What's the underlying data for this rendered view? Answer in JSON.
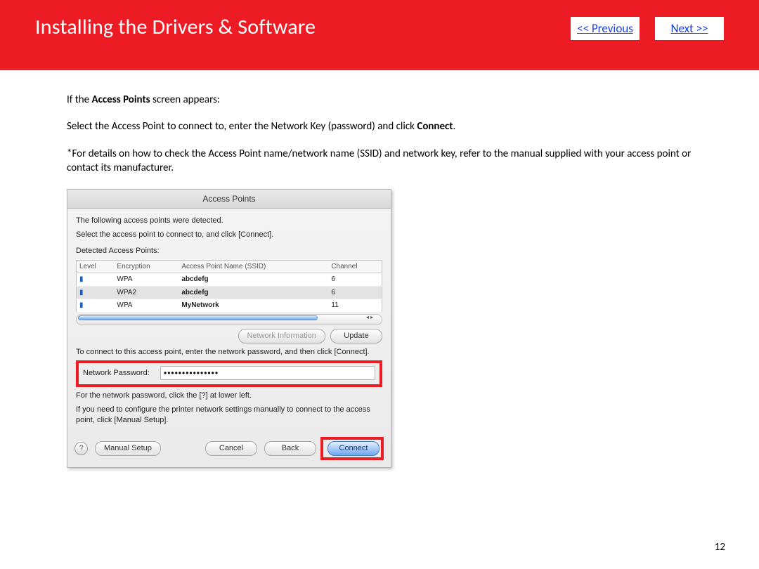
{
  "header": {
    "title": "Installing  the Drivers & Software",
    "prev": "<< Previous",
    "next": "Next >>"
  },
  "body": {
    "p1a": "If the ",
    "p1b": "Access Points",
    "p1c": " screen appears:",
    "p2a": "Select  the  Access Point to connect to, enter the Network Key (password) and click ",
    "p2b": "Connect",
    "p2c": ".",
    "note": "*For details on how to check the Access Point name/network name (SSID) and network key, refer to the manual supplied with your access point or contact its manufacturer."
  },
  "window": {
    "title": "Access Points",
    "intro1": "The following access points were detected.",
    "intro2": "Select the access point to connect to, and click [Connect].",
    "dap_label": "Detected Access Points:",
    "cols": {
      "level": "Level",
      "enc": "Encryption",
      "ssid": "Access Point Name (SSID)",
      "ch": "Channel"
    },
    "rows": [
      {
        "enc": "WPA",
        "ssid": "abcdefg",
        "ch": "6",
        "selected": false
      },
      {
        "enc": "WPA2",
        "ssid": "abcdefg",
        "ch": "6",
        "selected": true
      },
      {
        "enc": "WPA",
        "ssid": "MyNetwork",
        "ch": "11",
        "selected": false
      }
    ],
    "netinfo_btn": "Network Information",
    "update_btn": "Update",
    "connect_hint1": "To connect to this access point, enter the network password, and then click [Connect].",
    "pw_label": "Network Password:",
    "pw_value": "•••••••••••••••",
    "help1": "For the network password, click the [?] at lower left.",
    "help2": "If you need to configure the printer network settings manually to connect to the access point, click [Manual Setup].",
    "manual_btn": "Manual Setup",
    "cancel_btn": "Cancel",
    "back_btn": "Back",
    "connect_btn": "Connect"
  },
  "page_number": "12"
}
